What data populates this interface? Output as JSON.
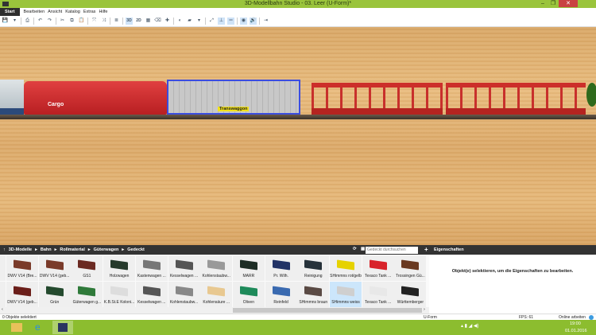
{
  "window": {
    "title": "3D-Modellbahn Studio - 03. Leer (U-Form)*",
    "minimize": "–",
    "restore": "❐",
    "close": "✕"
  },
  "menu": {
    "start": "Start",
    "items": [
      "Bearbeiten",
      "Ansicht",
      "Katalog",
      "Extras",
      "Hilfe"
    ]
  },
  "toolbar": {
    "view3d": "3D",
    "view2d": "2D"
  },
  "scene": {
    "wagon1_label": "Cargo",
    "wagon2_label": "Transwaggon"
  },
  "catalog": {
    "breadcrumb": [
      "3D-Modelle",
      "Bahn",
      "Rollmaterial",
      "Güterwagen",
      "Gedeckt"
    ],
    "search_placeholder": "Gedeckt durchsuchen",
    "add": "+",
    "row1": [
      {
        "label": "DWV V14 (Bre...",
        "color": "#7a3b2a"
      },
      {
        "label": "DWV V14 (geb...",
        "color": "#7a3b2a"
      },
      {
        "label": "GS1",
        "color": "#6b2a22"
      },
      {
        "label": "Holzwagen",
        "color": "#263a2c"
      },
      {
        "label": "Kastenwagen ...",
        "color": "#777"
      },
      {
        "label": "Kesselwagen ...",
        "color": "#555"
      },
      {
        "label": "Kohlenstaubw...",
        "color": "#999"
      },
      {
        "label": "MARR",
        "color": "#1d2d25"
      },
      {
        "label": "Pr. Wilh.",
        "color": "#223366"
      },
      {
        "label": "Reinigung",
        "color": "#26323a"
      },
      {
        "label": "SHimmns rot/gelb",
        "color": "#e6d200"
      },
      {
        "label": "Texaco Tank ...",
        "color": "#d8232a"
      },
      {
        "label": "Trossingen Gü...",
        "color": "#6a3a22"
      }
    ],
    "row2": [
      {
        "label": "DWV V14 (geb...",
        "color": "#6b1f1a"
      },
      {
        "label": "Grün",
        "color": "#244a2e"
      },
      {
        "label": "Güterwagen g...",
        "color": "#2f7a3a"
      },
      {
        "label": "K.B.St.E Koloni...",
        "color": "#ddd"
      },
      {
        "label": "Kesselwagen ...",
        "color": "#555"
      },
      {
        "label": "Kohlenstaubw...",
        "color": "#888"
      },
      {
        "label": "Kohlensäure ...",
        "color": "#e8c890"
      },
      {
        "label": "Oliven",
        "color": "#1e8a5a"
      },
      {
        "label": "Reinfeld",
        "color": "#3a6ab0"
      },
      {
        "label": "SHimmns braun",
        "color": "#5a4a44"
      },
      {
        "label": "SHimmns weiss",
        "color": "#cfcfcf"
      },
      {
        "label": "Texaco Tank ...",
        "color": "#e8e8e8"
      },
      {
        "label": "Württemberger",
        "color": "#222"
      }
    ],
    "selected": "SHimmns weiss"
  },
  "properties": {
    "title": "Eigenschaften",
    "hint": "Objekt(e) selektieren, um die Eigenschaften zu bearbeiten."
  },
  "status": {
    "selection": "0 Objekte selektiert",
    "layout": "U-Form",
    "fps": "FPS: 61",
    "online": "Online arbeiten"
  },
  "taskbar": {
    "time": "19:00",
    "date": "01.01.2016"
  }
}
